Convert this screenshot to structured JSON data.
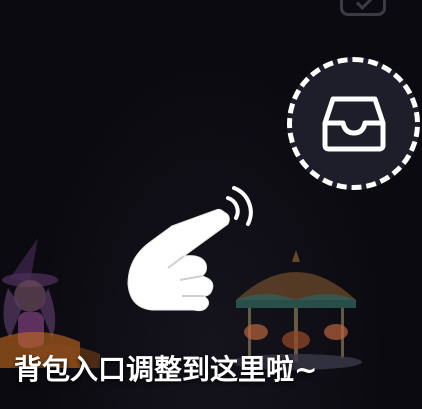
{
  "guide": {
    "message": "背包入口调整到这里啦~"
  },
  "icons": {
    "backpack": "inbox-tray-icon",
    "pointer": "tapping-hand-icon",
    "top_corner": "checklist-icon"
  },
  "colors": {
    "background": "#0b0a10",
    "highlight_fill": "#1e1e2a",
    "highlight_border": "#ffffff",
    "text": "#ffffff"
  }
}
